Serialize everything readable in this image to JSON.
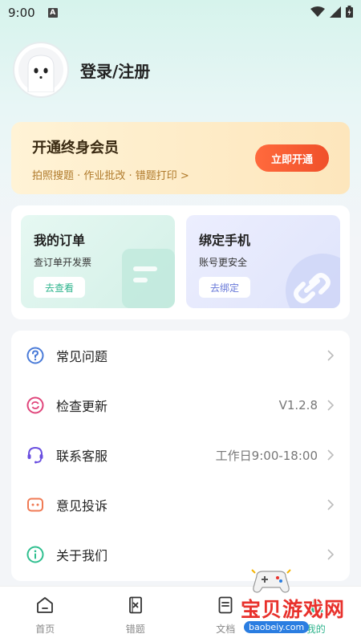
{
  "status_bar": {
    "time": "9:00",
    "notification_badge": "A",
    "icons": [
      "wifi-icon",
      "signal-icon",
      "battery-icon"
    ]
  },
  "profile": {
    "login_label": "登录/注册",
    "avatar_icon": "ghost-avatar-icon"
  },
  "vip": {
    "title": "开通终身会员",
    "subtitle": "拍照搜题 · 作业批改 · 错题打印 >",
    "button_label": "立即开通"
  },
  "quick_cards": {
    "order": {
      "title": "我的订单",
      "subtitle": "查订单开发票",
      "button": "去查看"
    },
    "phone": {
      "title": "绑定手机",
      "subtitle": "账号更安全",
      "button": "去绑定"
    }
  },
  "menu": {
    "items": [
      {
        "label": "常见问题",
        "value": "",
        "icon": "question-icon",
        "color": "#4a7bd8"
      },
      {
        "label": "检查更新",
        "value": "V1.2.8",
        "icon": "refresh-icon",
        "color": "#e0457b"
      },
      {
        "label": "联系客服",
        "value": "工作日9:00-18:00",
        "icon": "headset-icon",
        "color": "#6a4fe0"
      },
      {
        "label": "意见投诉",
        "value": "",
        "icon": "feedback-icon",
        "color": "#f07a54"
      },
      {
        "label": "关于我们",
        "value": "",
        "icon": "info-icon",
        "color": "#2fbf8f"
      }
    ]
  },
  "bottom_nav": {
    "items": [
      {
        "label": "首页",
        "icon": "home-icon"
      },
      {
        "label": "错题",
        "icon": "mistakes-icon"
      },
      {
        "label": "文档",
        "icon": "document-icon"
      },
      {
        "label": "我的",
        "icon": "profile-icon",
        "active": true
      }
    ]
  },
  "watermark": {
    "text": "宝贝游戏网",
    "url": "baobeiy.com"
  },
  "colors": {
    "accent": "#2fb48d",
    "vip_button": "#f0502a"
  }
}
